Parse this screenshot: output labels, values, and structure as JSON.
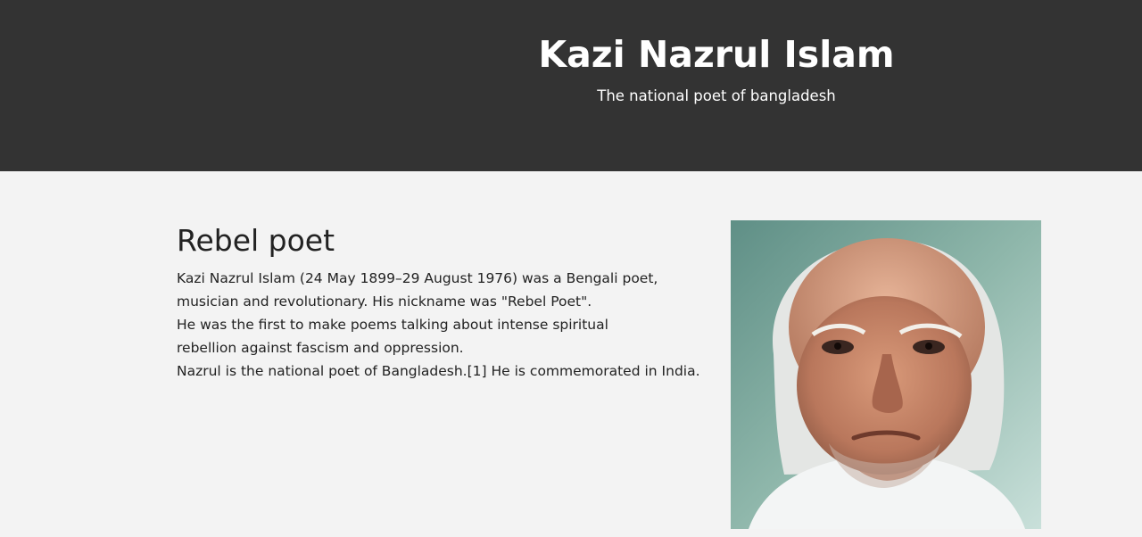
{
  "header": {
    "title": "Kazi Nazrul Islam",
    "subtitle": "The national poet of bangladesh"
  },
  "main": {
    "heading": "Rebel poet",
    "paragraph_lines": [
      "Kazi Nazrul Islam (24 May 1899–29 August 1976) was a Bengali poet,",
      "musician and revolutionary. His nickname was \"Rebel Poet\".",
      "He was the first to make poems talking about intense spiritual",
      "rebellion against fascism and oppression.",
      "Nazrul is the national poet of Bangladesh.[1] He is commemorated in India."
    ],
    "portrait_colors": {
      "background": "#7fa89a",
      "skin": "#c98a6c",
      "hair": "#e8e8e8",
      "shirt": "#f4f6f6"
    }
  }
}
